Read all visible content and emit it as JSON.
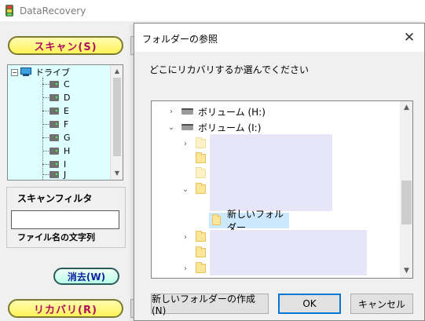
{
  "app": {
    "title": "DataRecovery",
    "scan_button": "スキャン(S)",
    "recover_button": "リカバリ(R)",
    "clear_button": "消去(W)",
    "drive_tree": {
      "root_label": "ドライブ",
      "drives": [
        "C",
        "D",
        "E",
        "F",
        "G",
        "H",
        "I",
        "J"
      ]
    },
    "filter": {
      "title": "スキャンフィルタ",
      "input_value": "",
      "caption": "ファイル名の文字列"
    }
  },
  "dialog": {
    "title": "フォルダーの参照",
    "close_glyph": "✕",
    "prompt": "どこにリカバリするか選んでください",
    "tree": {
      "volume_h": "ボリューム (H:)",
      "volume_i": "ボリューム (I:)",
      "selected_folder": "新しいフォルダー"
    },
    "buttons": {
      "new_folder": "新しいフォルダーの作成(N)",
      "ok": "OK",
      "cancel": "キャンセル"
    }
  }
}
